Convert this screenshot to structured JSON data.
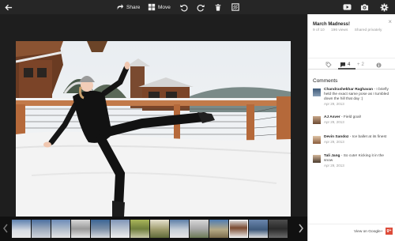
{
  "toolbar": {
    "share_label": "Share",
    "move_label": "Move"
  },
  "photo": {
    "title": "March Madness!",
    "position": "9 of 10",
    "views": "196 views",
    "visibility": "Shared privately"
  },
  "tabs": {
    "comments_count": "4",
    "plus_count": "2"
  },
  "comments": {
    "header": "Comments",
    "items": [
      {
        "name": "Chandrashekhar Raghavan",
        "text": "- I briefly held the exact same pose as I tumbled down the hill that day :)",
        "date": "Apr 29, 2013"
      },
      {
        "name": "AJ Asver",
        "text": "- Field goal!",
        "date": "Apr 29, 2013"
      },
      {
        "name": "Devin Sandoz",
        "text": "- Ice ballet at its finest",
        "date": "Apr 29, 2013"
      },
      {
        "name": "Tali Jang",
        "text": "- So cute! Kicking it in the snow",
        "date": "Apr 29, 2013"
      }
    ]
  },
  "footer": {
    "view_link": "View on Google+",
    "gplus_badge": "g+"
  },
  "colors": {
    "accent": "#dd4b39",
    "toolbar_bg": "#262626",
    "panel_bg": "#ffffff"
  },
  "icons": [
    "back-arrow-icon",
    "share-icon",
    "move-icon",
    "rotate-left-icon",
    "rotate-right-icon",
    "trash-icon",
    "edit-icon",
    "youtube-icon",
    "camera-icon",
    "settings-icon",
    "tag-icon",
    "comment-icon",
    "plus-one-icon",
    "info-icon",
    "chevron-left-icon",
    "chevron-right-icon"
  ]
}
